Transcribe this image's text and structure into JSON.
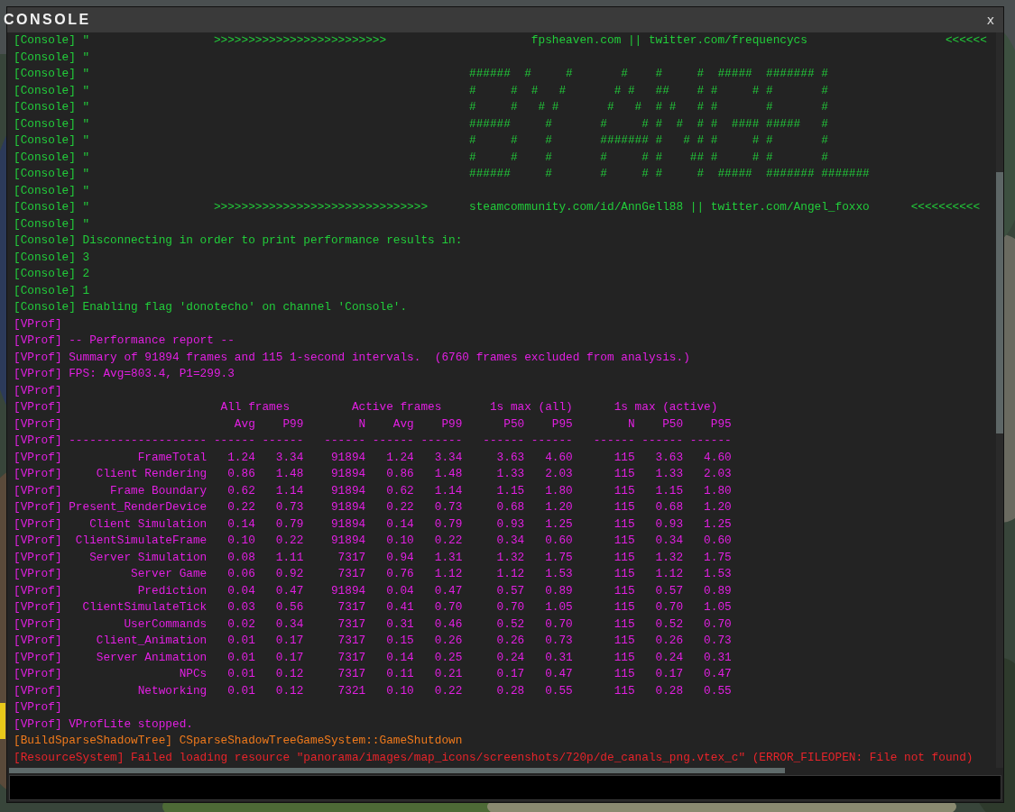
{
  "window": {
    "title": "CONSOLE",
    "close": "x"
  },
  "log": [
    {
      "kind": "console",
      "text": "[Console] \"                  >>>>>>>>>>>>>>>>>>>>>>>>>                     fpsheaven.com || twitter.com/frequencycs                    <<<<<<"
    },
    {
      "kind": "console",
      "text": "[Console] \""
    },
    {
      "kind": "console",
      "text": "[Console] \"                                                       ######  #     #       #    #     #  #####  ####### #"
    },
    {
      "kind": "console",
      "text": "[Console] \"                                                       #     #  #   #       # #   ##    # #     # #       #"
    },
    {
      "kind": "console",
      "text": "[Console] \"                                                       #     #   # #       #   #  # #   # #       #       #"
    },
    {
      "kind": "console",
      "text": "[Console] \"                                                       ######     #       #     # #  #  # #  #### #####   #"
    },
    {
      "kind": "console",
      "text": "[Console] \"                                                       #     #    #       ####### #   # # #     # #       #"
    },
    {
      "kind": "console",
      "text": "[Console] \"                                                       #     #    #       #     # #    ## #     # #       #"
    },
    {
      "kind": "console",
      "text": "[Console] \"                                                       ######     #       #     # #     #  #####  ####### #######"
    },
    {
      "kind": "console",
      "text": "[Console] \""
    },
    {
      "kind": "console",
      "text": "[Console] \"                  >>>>>>>>>>>>>>>>>>>>>>>>>>>>>>>      steamcommunity.com/id/AnnGell88 || twitter.com/Angel_foxxo      <<<<<<<<<<"
    },
    {
      "kind": "console",
      "text": "[Console] \""
    },
    {
      "kind": "console",
      "text": "[Console] Disconnecting in order to print performance results in:"
    },
    {
      "kind": "console",
      "text": "[Console] 3"
    },
    {
      "kind": "console",
      "text": "[Console] 2"
    },
    {
      "kind": "console",
      "text": "[Console] 1"
    },
    {
      "kind": "console",
      "text": "[Console] Enabling flag 'donotecho' on channel 'Console'."
    },
    {
      "kind": "vprof",
      "text": "[VProf]"
    },
    {
      "kind": "vprof",
      "text": "[VProf] -- Performance report --"
    },
    {
      "kind": "vprof",
      "text": "[VProf] Summary of 91894 frames and 115 1-second intervals.  (6760 frames excluded from analysis.)"
    },
    {
      "kind": "vprof",
      "text": "[VProf] FPS: Avg=803.4, P1=299.3"
    },
    {
      "kind": "vprof",
      "text": "[VProf]"
    },
    {
      "kind": "vprof",
      "text": "[VProf]                       All frames         Active frames       1s max (all)      1s max (active)"
    },
    {
      "kind": "vprof",
      "text": "[VProf]                         Avg    P99        N    Avg    P99      P50    P95        N    P50    P95"
    },
    {
      "kind": "vprof",
      "prefix": "[VProf]",
      "cells": [
        "--------------------",
        "------",
        "------",
        "------",
        "------",
        "------",
        "------",
        "------",
        "------",
        "------",
        "------"
      ]
    },
    {
      "kind": "vprof",
      "prefix": "[VProf]",
      "cells": [
        "FrameTotal",
        "1.24",
        "3.34",
        "91894",
        "1.24",
        "3.34",
        "3.63",
        "4.60",
        "115",
        "3.63",
        "4.60"
      ]
    },
    {
      "kind": "vprof",
      "prefix": "[VProf]",
      "cells": [
        "Client Rendering",
        "0.86",
        "1.48",
        "91894",
        "0.86",
        "1.48",
        "1.33",
        "2.03",
        "115",
        "1.33",
        "2.03"
      ]
    },
    {
      "kind": "vprof",
      "prefix": "[VProf]",
      "cells": [
        "Frame Boundary",
        "0.62",
        "1.14",
        "91894",
        "0.62",
        "1.14",
        "1.15",
        "1.80",
        "115",
        "1.15",
        "1.80"
      ]
    },
    {
      "kind": "vprof",
      "prefix": "[VProf]",
      "cells": [
        "Present_RenderDevice",
        "0.22",
        "0.73",
        "91894",
        "0.22",
        "0.73",
        "0.68",
        "1.20",
        "115",
        "0.68",
        "1.20"
      ]
    },
    {
      "kind": "vprof",
      "prefix": "[VProf]",
      "cells": [
        "Client Simulation",
        "0.14",
        "0.79",
        "91894",
        "0.14",
        "0.79",
        "0.93",
        "1.25",
        "115",
        "0.93",
        "1.25"
      ]
    },
    {
      "kind": "vprof",
      "prefix": "[VProf]",
      "cells": [
        "ClientSimulateFrame",
        "0.10",
        "0.22",
        "91894",
        "0.10",
        "0.22",
        "0.34",
        "0.60",
        "115",
        "0.34",
        "0.60"
      ]
    },
    {
      "kind": "vprof",
      "prefix": "[VProf]",
      "cells": [
        "Server Simulation",
        "0.08",
        "1.11",
        "7317",
        "0.94",
        "1.31",
        "1.32",
        "1.75",
        "115",
        "1.32",
        "1.75"
      ]
    },
    {
      "kind": "vprof",
      "prefix": "[VProf]",
      "cells": [
        "Server Game",
        "0.06",
        "0.92",
        "7317",
        "0.76",
        "1.12",
        "1.12",
        "1.53",
        "115",
        "1.12",
        "1.53"
      ]
    },
    {
      "kind": "vprof",
      "prefix": "[VProf]",
      "cells": [
        "Prediction",
        "0.04",
        "0.47",
        "91894",
        "0.04",
        "0.47",
        "0.57",
        "0.89",
        "115",
        "0.57",
        "0.89"
      ]
    },
    {
      "kind": "vprof",
      "prefix": "[VProf]",
      "cells": [
        "ClientSimulateTick",
        "0.03",
        "0.56",
        "7317",
        "0.41",
        "0.70",
        "0.70",
        "1.05",
        "115",
        "0.70",
        "1.05"
      ]
    },
    {
      "kind": "vprof",
      "prefix": "[VProf]",
      "cells": [
        "UserCommands",
        "0.02",
        "0.34",
        "7317",
        "0.31",
        "0.46",
        "0.52",
        "0.70",
        "115",
        "0.52",
        "0.70"
      ]
    },
    {
      "kind": "vprof",
      "prefix": "[VProf]",
      "cells": [
        "Client_Animation",
        "0.01",
        "0.17",
        "7317",
        "0.15",
        "0.26",
        "0.26",
        "0.73",
        "115",
        "0.26",
        "0.73"
      ]
    },
    {
      "kind": "vprof",
      "prefix": "[VProf]",
      "cells": [
        "Server Animation",
        "0.01",
        "0.17",
        "7317",
        "0.14",
        "0.25",
        "0.24",
        "0.31",
        "115",
        "0.24",
        "0.31"
      ]
    },
    {
      "kind": "vprof",
      "prefix": "[VProf]",
      "cells": [
        "NPCs",
        "0.01",
        "0.12",
        "7317",
        "0.11",
        "0.21",
        "0.17",
        "0.47",
        "115",
        "0.17",
        "0.47"
      ]
    },
    {
      "kind": "vprof",
      "prefix": "[VProf]",
      "cells": [
        "Networking",
        "0.01",
        "0.12",
        "7321",
        "0.10",
        "0.22",
        "0.28",
        "0.55",
        "115",
        "0.28",
        "0.55"
      ]
    },
    {
      "kind": "vprof",
      "text": "[VProf]"
    },
    {
      "kind": "vprof",
      "text": "[VProf] VProfLite stopped."
    },
    {
      "kind": "warning",
      "text": "[BuildSparseShadowTree] CSparseShadowTreeGameSystem::GameShutdown"
    },
    {
      "kind": "error",
      "text": "[ResourceSystem] Failed loading resource \"panorama/images/map_icons/screenshots/720p/de_canals_png.vtex_c\" (ERROR_FILEOPEN: File not found)"
    }
  ]
}
